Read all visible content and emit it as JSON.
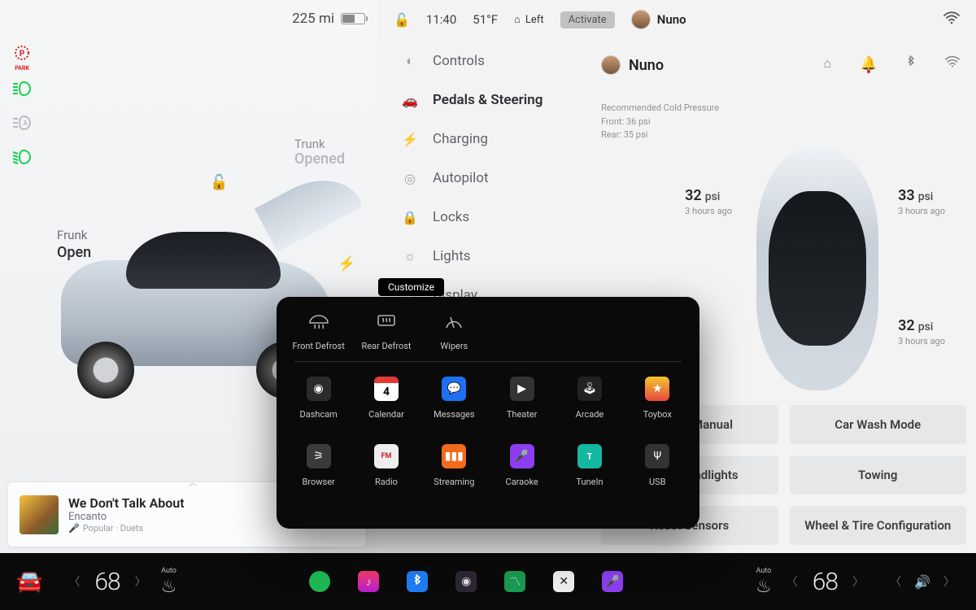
{
  "range": {
    "miles": "225",
    "unit": "mi"
  },
  "topbar": {
    "time": "11:40",
    "temp": "51°F",
    "home_side": "Left",
    "activate": "Activate"
  },
  "user": {
    "name": "Nuno"
  },
  "indicators": {
    "park": "PARK"
  },
  "frunk": {
    "label": "Frunk",
    "state": "Open"
  },
  "trunk": {
    "label": "Trunk",
    "state": "Opened"
  },
  "media": {
    "title": "We Don't Talk About",
    "artist": "Encanto",
    "source": "Popular · Duets"
  },
  "nav": {
    "controls": "Controls",
    "pedals": "Pedals & Steering",
    "charging": "Charging",
    "autopilot": "Autopilot",
    "locks": "Locks",
    "lights": "Lights",
    "display": "Display"
  },
  "tire_note": {
    "line1": "Recommended Cold Pressure",
    "line2": "Front: 36 psi",
    "line3": "Rear: 35 psi"
  },
  "psi": {
    "unit": "psi",
    "fl": {
      "v": "32",
      "age": "3 hours ago"
    },
    "fr": {
      "v": "33",
      "age": "3 hours ago"
    },
    "rr": {
      "v": "32",
      "age": "3 hours ago"
    }
  },
  "buttons": {
    "manual": "Owner's Manual",
    "carwash": "Car Wash Mode",
    "headlights": "Adjust Headlights",
    "towing": "Towing",
    "sensors": "Reset Sensors",
    "wheel": "Wheel & Tire Configuration"
  },
  "customize": {
    "chip": "Customize"
  },
  "popover": {
    "row1": {
      "front_defrost": "Front Defrost",
      "rear_defrost": "Rear Defrost",
      "wipers": "Wipers"
    },
    "row2": {
      "dashcam": "Dashcam",
      "calendar": "Calendar",
      "calendar_day": "4",
      "messages": "Messages",
      "theater": "Theater",
      "arcade": "Arcade",
      "toybox": "Toybox"
    },
    "row3": {
      "browser": "Browser",
      "radio": "Radio",
      "radio_band": "FM",
      "streaming": "Streaming",
      "caraoke": "Caraoke",
      "tunein": "TuneIn",
      "usb": "USB"
    }
  },
  "dock": {
    "temp_l": "68",
    "temp_r": "68",
    "auto": "Auto"
  }
}
